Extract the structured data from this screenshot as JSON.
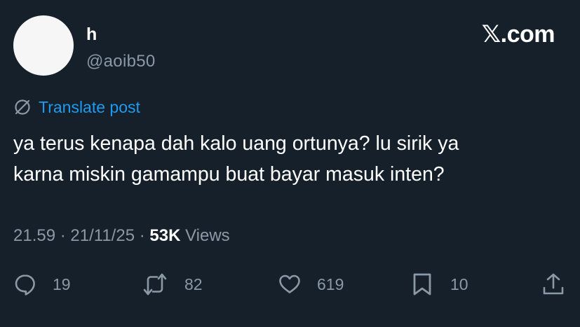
{
  "post": {
    "author_name": "h",
    "author_handle": "@aoib50",
    "brand": "𝕏.com",
    "translate_label": "Translate post",
    "text_line1": "ya terus kenapa dah kalo uang ortunya? lu sirik ya",
    "text_line2": "karna miskin gamampu buat bayar masuk inten?",
    "time": "21.59",
    "date": "21/11/25",
    "views_count": "53K",
    "views_label": "Views",
    "separator": "·"
  },
  "actions": {
    "replies": "19",
    "reposts": "82",
    "likes": "619",
    "bookmarks": "10"
  },
  "colors": {
    "background": "#15202b",
    "accent": "#1d9bf0",
    "muted": "#8b98a5",
    "text": "#ffffff"
  },
  "icons": [
    "translate-icon",
    "reply-icon",
    "repost-icon",
    "like-icon",
    "bookmark-icon",
    "share-icon"
  ]
}
